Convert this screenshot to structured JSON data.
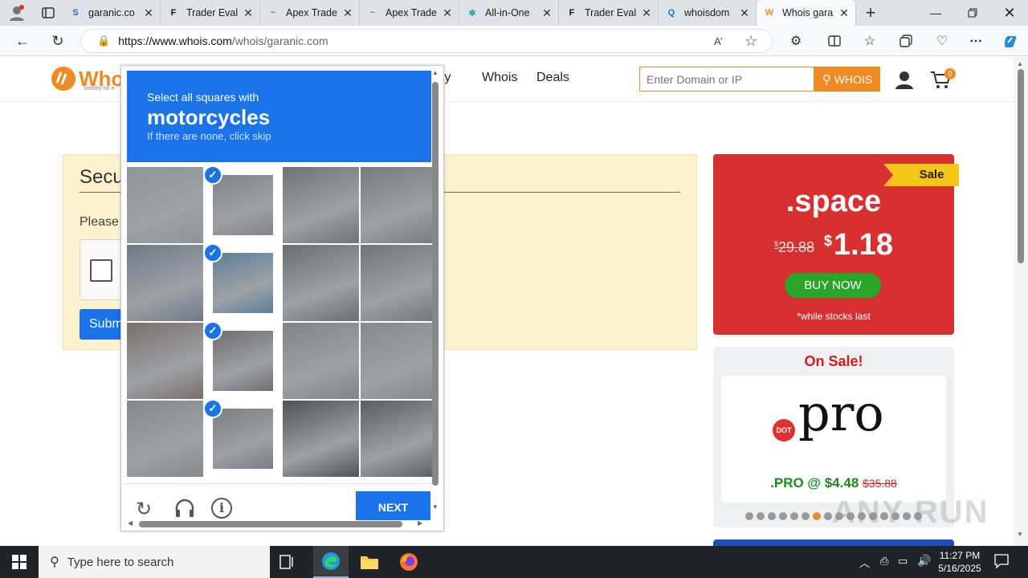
{
  "browser": {
    "tabs": [
      {
        "label": "garanic.co",
        "favicon": "S",
        "color": "#1e6fd6"
      },
      {
        "label": "Trader Eval",
        "favicon": "F",
        "color": "#111"
      },
      {
        "label": "Apex Trade",
        "favicon": "~",
        "color": "#777"
      },
      {
        "label": "Apex Trade",
        "favicon": "~",
        "color": "#777"
      },
      {
        "label": "All-in-One",
        "favicon": "✱",
        "color": "#3aa"
      },
      {
        "label": "Trader Eval",
        "favicon": "F",
        "color": "#111"
      },
      {
        "label": "whoisdom",
        "favicon": "Q",
        "color": "#1e6fd6"
      },
      {
        "label": "Whois gara",
        "favicon": "W",
        "color": "#f08a24"
      }
    ],
    "url_host": "https://www.whois.com",
    "url_path": "/whois/garanic.com",
    "new_tab": "+"
  },
  "site": {
    "logo": "Who",
    "logo_tagline": "Identity for e",
    "nav": {
      "security": "rity",
      "whois": "Whois",
      "deals": "Deals"
    },
    "search_placeholder": "Enter Domain or IP",
    "search_button": "WHOIS",
    "cart_count": "0"
  },
  "secure": {
    "title": "Secu",
    "prompt": "Please",
    "submit": "Subm"
  },
  "promo": {
    "ribbon": "Sale",
    "tld": ".space",
    "old_price": "29.88",
    "currency": "$",
    "new_price": "1.18",
    "buy_button": "BUY NOW",
    "note": "*while stocks last"
  },
  "onsale": {
    "heading": "On Sale!",
    "badge": "DOT",
    "tld_word": "pro",
    "price": ".PRO @ $4.48",
    "old_price": "$35.88",
    "dots_total": 16,
    "dots_active": 6
  },
  "captcha": {
    "instruction": "Select all squares with",
    "target": "motorcycles",
    "hint": "If there are none, click skip",
    "next_button": "NEXT",
    "selected": [
      1,
      5,
      9,
      13
    ]
  },
  "taskbar": {
    "search_placeholder": "Type here to search",
    "time": "11:27 PM",
    "date": "5/16/2025"
  },
  "watermark": "ANY RUN"
}
